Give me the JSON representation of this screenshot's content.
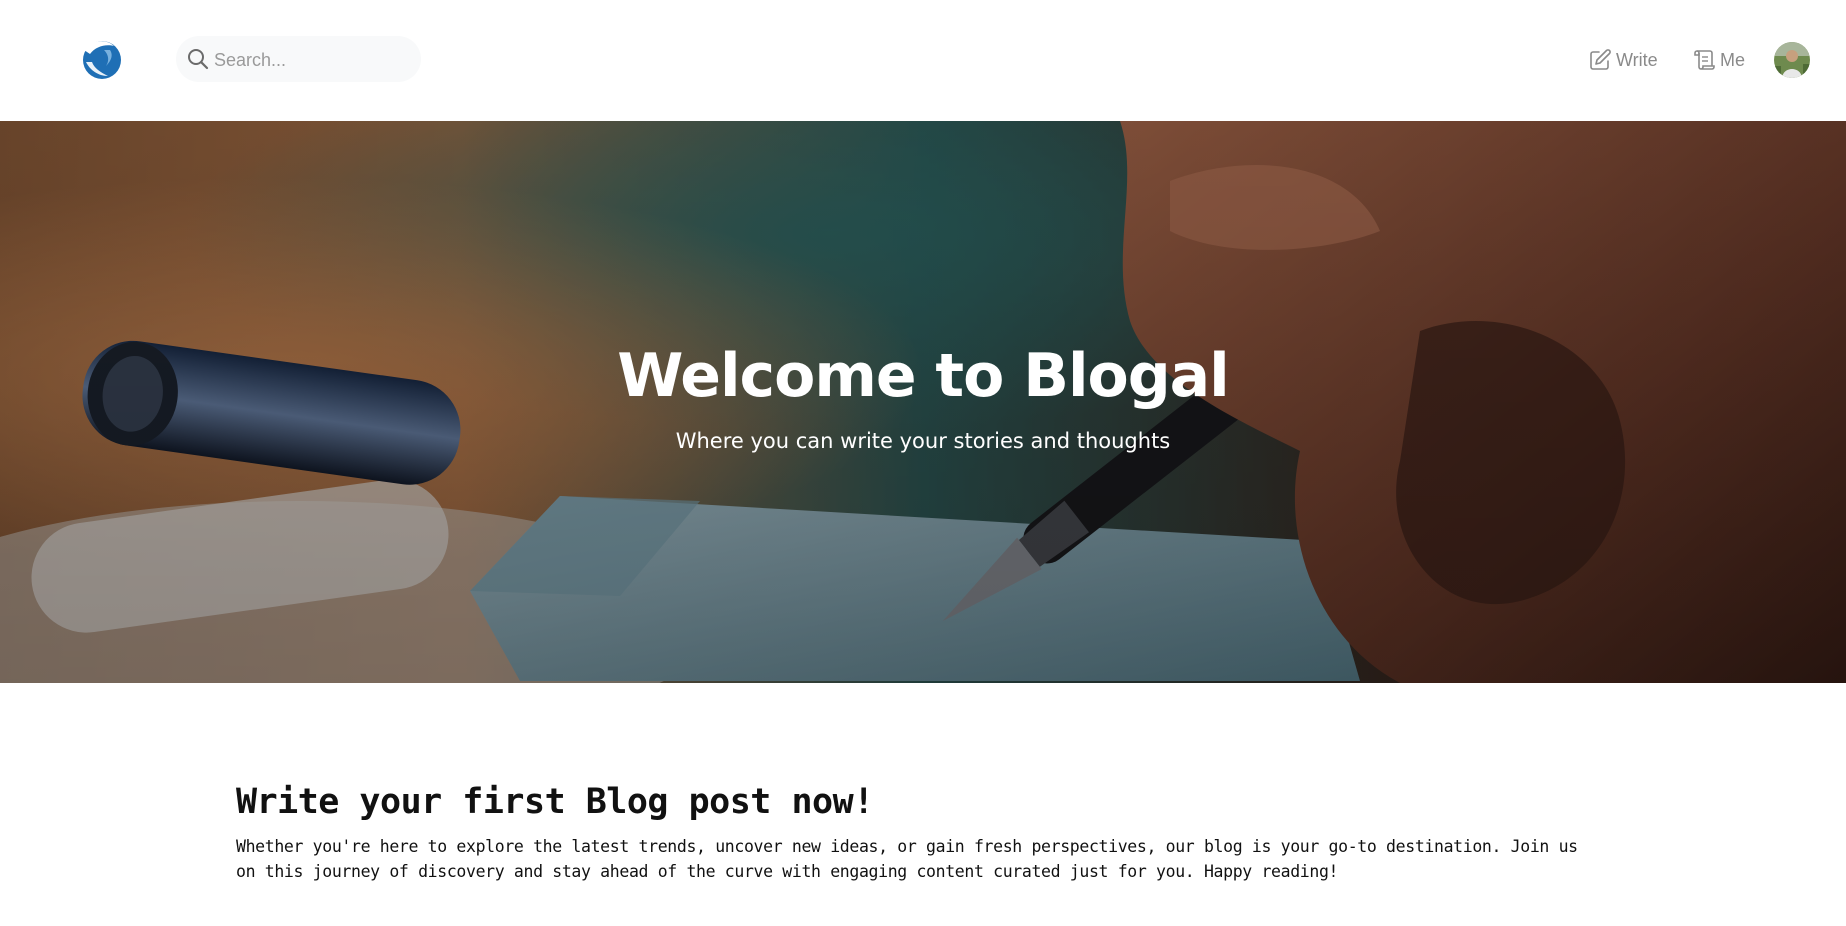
{
  "navbar": {
    "logo_icon": "blogal-logo-icon",
    "search": {
      "placeholder": "Search...",
      "value": "",
      "icon": "search-icon"
    },
    "write_label": "Write",
    "write_icon": "pencil-square-icon",
    "me_label": "Me",
    "me_icon": "scroll-icon",
    "avatar_icon": "user-avatar"
  },
  "hero": {
    "title": "Welcome to Blogal",
    "subtitle": "Where you can write your stories and thoughts"
  },
  "main": {
    "title": "Write your first Blog post now!",
    "body": "Whether you're here to explore the latest trends, uncover new ideas, or gain fresh perspectives, our blog is your go-to destination. Join us on this journey of discovery and stay ahead of the curve with engaging content curated just for you. Happy reading!"
  },
  "colors": {
    "logo_blue": "#1f6fb5",
    "nav_text": "#8a8a8a",
    "search_bg": "#f8f9fa",
    "hero_text": "#ffffff",
    "content_text": "#111111"
  }
}
